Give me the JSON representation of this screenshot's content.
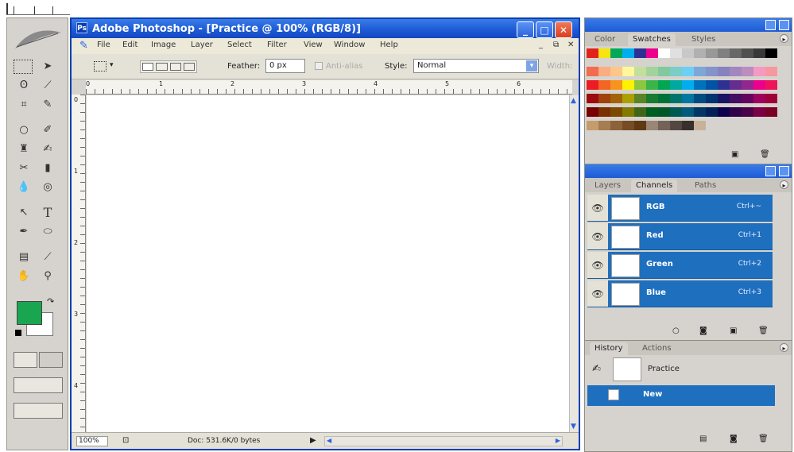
{
  "window": {
    "title": "Adobe Photoshop - [Practice @ 100% (RGB/8)]",
    "minimize_icon": "minimize-icon",
    "maximize_icon": "maximize-icon",
    "close_icon": "close-icon"
  },
  "menubar": {
    "items": [
      "File",
      "Edit",
      "Image",
      "Layer",
      "Select",
      "Filter",
      "View",
      "Window",
      "Help"
    ]
  },
  "options": {
    "feather_label": "Feather:",
    "feather_value": "0 px",
    "antialias_label": "Anti-alias",
    "style_label": "Style:",
    "style_value": "Normal",
    "width_label": "Width:"
  },
  "rulers": {
    "h_ticks": [
      "0",
      "1",
      "2",
      "3",
      "4",
      "5",
      "6"
    ],
    "v_ticks": [
      "0",
      "1",
      "2",
      "3",
      "4"
    ]
  },
  "status": {
    "zoom": "100%",
    "doc": "Doc: 531.6K/0 bytes"
  },
  "swatches_panel": {
    "tabs": [
      "Color",
      "Swatches",
      "Styles"
    ],
    "active_tab": "Swatches",
    "colors": [
      [
        "#e2231a",
        "#f7e411",
        "#00a859",
        "#00aeef",
        "#2e3192",
        "#ec008c",
        "#ffffff",
        "#e0e0e0",
        "#c8c8c8",
        "#b0b0b0",
        "#989898",
        "#808080",
        "#686868",
        "#505050",
        "#383838",
        "#000000"
      ],
      [
        "#f26c4f",
        "#f9ad81",
        "#fdc68a",
        "#fff799",
        "#c4df9b",
        "#a3d39c",
        "#82ca9d",
        "#7bcdc8",
        "#6ecff6",
        "#7ea7d8",
        "#8493ca",
        "#8882be",
        "#a187be",
        "#bc8dbf",
        "#f49ac2",
        "#f6989d"
      ],
      [
        "#ed1c24",
        "#f26522",
        "#f7941d",
        "#fff200",
        "#8dc73f",
        "#39b54a",
        "#00a651",
        "#00a99d",
        "#00aeef",
        "#0072bc",
        "#0054a6",
        "#2e3192",
        "#662d91",
        "#92278f",
        "#ec008c",
        "#ed145b"
      ],
      [
        "#9e0b0f",
        "#a0410d",
        "#a36209",
        "#aba000",
        "#598527",
        "#1a7b30",
        "#007236",
        "#00746b",
        "#0076a3",
        "#004b80",
        "#003471",
        "#1b1464",
        "#440e62",
        "#630460",
        "#9e005d",
        "#9e0039"
      ],
      [
        "#790000",
        "#7b2e00",
        "#7d4900",
        "#827b00",
        "#406618",
        "#005e20",
        "#005826",
        "#005952",
        "#005b7f",
        "#003663",
        "#002157",
        "#0d004c",
        "#32004b",
        "#4b0049",
        "#7b0046",
        "#7a0026"
      ],
      [
        "#c69c6d",
        "#a67c52",
        "#8c6239",
        "#754c24",
        "#603913",
        "#998675",
        "#736357",
        "#534741",
        "#37302d",
        "#c7b299",
        "#",
        "#",
        "#",
        "#",
        "#",
        "#"
      ]
    ]
  },
  "channels_panel": {
    "tabs": [
      "Layers",
      "Channels",
      "Paths"
    ],
    "active_tab": "Channels",
    "channels": [
      {
        "name": "RGB",
        "shortcut": "Ctrl+~"
      },
      {
        "name": "Red",
        "shortcut": "Ctrl+1"
      },
      {
        "name": "Green",
        "shortcut": "Ctrl+2"
      },
      {
        "name": "Blue",
        "shortcut": "Ctrl+3"
      }
    ]
  },
  "history_panel": {
    "tabs": [
      "History",
      "Actions"
    ],
    "active_tab": "History",
    "snapshot": "Practice",
    "states": [
      "New"
    ]
  },
  "colors": {
    "foreground": "#1aa550",
    "background": "#ffffff",
    "selection": "#1f6fbf"
  }
}
